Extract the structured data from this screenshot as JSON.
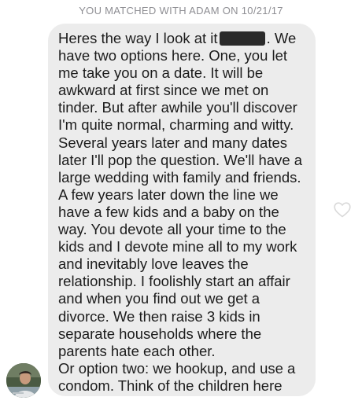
{
  "header": {
    "match_text": "YOU MATCHED WITH ADAM ON 10/21/17"
  },
  "message": {
    "line1_pre": "Heres the way I look at it",
    "line1_post": ". We",
    "lines": [
      "have two options here. One, you let",
      "me take you on a date. It will be",
      "awkward at first since we met on",
      "tinder. But after awhile you'll discover",
      "I'm quite normal, charming and witty.",
      "Several years later and many dates",
      "later I'll pop the question. We'll have a",
      "large wedding with family and friends.",
      "A few years later down the line we",
      "have a few kids and a baby on the",
      "way. You devote all your time to the",
      "kids and I devote mine all to my work",
      "and inevitably love leaves the",
      "relationship. I foolishly start an affair",
      "and when you find out we get a",
      "divorce. We then raise 3 kids in",
      "separate households where the",
      "parents hate each other.",
      "Or option two: we hookup, and use a",
      "condom. Think of the children here"
    ]
  },
  "icons": {
    "like": "heart-outline-icon",
    "avatar": "profile-photo"
  },
  "colors": {
    "bubble_bg": "#ececec",
    "text": "#1c1c1c",
    "header": "#8e8e93",
    "heart": "#d9d9d9"
  }
}
